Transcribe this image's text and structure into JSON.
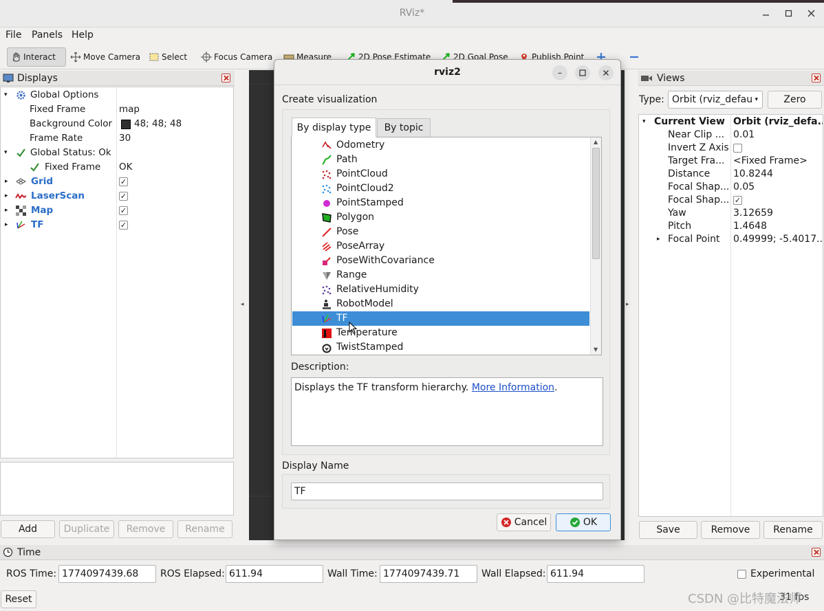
{
  "window": {
    "title": "RViz*"
  },
  "menu": {
    "file": "File",
    "panels": "Panels",
    "help": "Help"
  },
  "toolbar": {
    "interact": "Interact",
    "move_camera": "Move Camera",
    "select": "Select",
    "focus_camera": "Focus Camera",
    "measure": "Measure",
    "pose_estimate": "2D Pose Estimate",
    "goal_pose": "2D Goal Pose",
    "publish_point": "Publish Point"
  },
  "displays": {
    "title": "Displays",
    "global_options": "Global Options",
    "fixed_frame_label": "Fixed Frame",
    "fixed_frame_value": "map",
    "bg_color_label": "Background Color",
    "bg_color_value": "48; 48; 48",
    "bg_color_hex": "#303030",
    "frame_rate_label": "Frame Rate",
    "frame_rate_value": "30",
    "global_status": "Global Status: Ok",
    "status_fixed_frame_label": "Fixed Frame",
    "status_fixed_frame_value": "OK",
    "items": [
      "Grid",
      "LaserScan",
      "Map",
      "TF"
    ],
    "buttons": {
      "add": "Add",
      "duplicate": "Duplicate",
      "remove": "Remove",
      "rename": "Rename"
    }
  },
  "dialog": {
    "title": "rviz2",
    "section_label": "Create visualization",
    "tab_display_type": "By display type",
    "tab_topic": "By topic",
    "list": [
      "Odometry",
      "Path",
      "PointCloud",
      "PointCloud2",
      "PointStamped",
      "Polygon",
      "Pose",
      "PoseArray",
      "PoseWithCovariance",
      "Range",
      "RelativeHumidity",
      "RobotModel",
      "TF",
      "Temperature",
      "TwistStamped"
    ],
    "selected": "TF",
    "description_label": "Description:",
    "description_text": "Displays the TF transform hierarchy. ",
    "description_link": "More Information",
    "description_end": ".",
    "display_name_label": "Display Name",
    "display_name_value": "TF",
    "cancel": "Cancel",
    "ok": "OK"
  },
  "views": {
    "title": "Views",
    "type_label": "Type:",
    "type_value": "Orbit (rviz_defau",
    "zero": "Zero",
    "current_view_label": "Current View",
    "current_view_value": "Orbit (rviz_defa...",
    "props": [
      {
        "label": "Near Clip ...",
        "value": "0.01"
      },
      {
        "label": "Invert Z Axis",
        "value": ""
      },
      {
        "label": "Target Fra...",
        "value": "<Fixed Frame>"
      },
      {
        "label": "Distance",
        "value": "10.8244"
      },
      {
        "label": "Focal Shap...",
        "value": "0.05"
      },
      {
        "label": "Focal Shap...",
        "value": ""
      },
      {
        "label": "Yaw",
        "value": "3.12659"
      },
      {
        "label": "Pitch",
        "value": "1.4648"
      },
      {
        "label": "Focal Point",
        "value": "0.49999; -5.4017..."
      }
    ],
    "buttons": {
      "save": "Save",
      "remove": "Remove",
      "rename": "Rename"
    }
  },
  "time": {
    "title": "Time",
    "ros_time_label": "ROS Time:",
    "ros_time_value": "1774097439.68",
    "ros_elapsed_label": "ROS Elapsed:",
    "ros_elapsed_value": "611.94",
    "wall_time_label": "Wall Time:",
    "wall_time_value": "1774097439.71",
    "wall_elapsed_label": "Wall Elapsed:",
    "wall_elapsed_value": "611.94",
    "experimental": "Experimental",
    "reset": "Reset",
    "fps": "31 fps"
  },
  "watermark": "CSDN @比特魔法师"
}
